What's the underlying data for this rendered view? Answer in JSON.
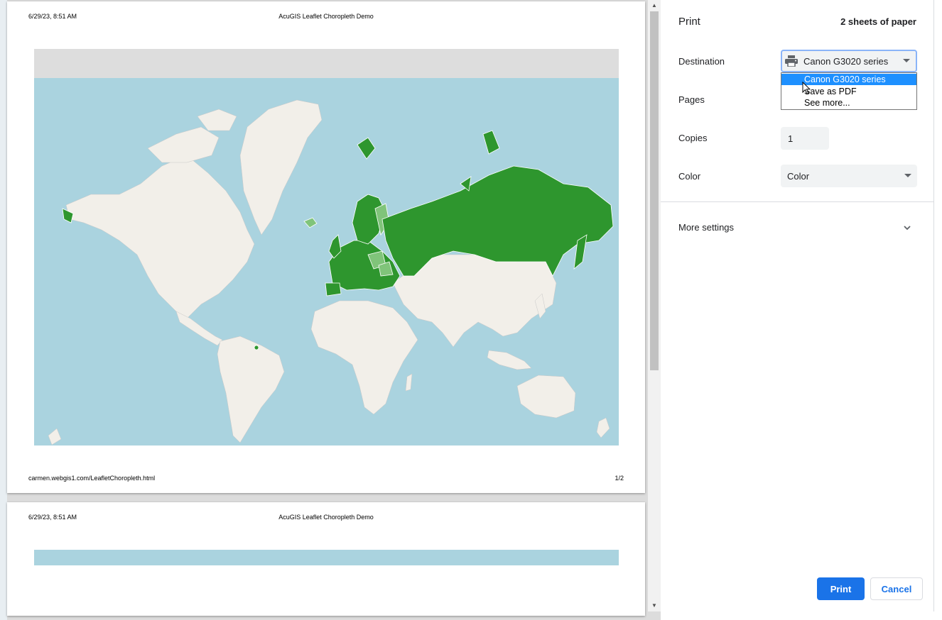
{
  "preview": {
    "page1": {
      "header_date": "6/29/23, 8:51 AM",
      "header_title": "AcuGIS Leaflet Choropleth Demo",
      "footer_url": "carmen.webgis1.com/LeafletChoropleth.html",
      "footer_page": "1/2"
    },
    "page2": {
      "header_date": "6/29/23, 8:51 AM",
      "header_title": "AcuGIS Leaflet Choropleth Demo"
    },
    "map_colors": {
      "ocean": "#aad3df",
      "land": "#f2efe9",
      "choropleth_dark": "#2e962e",
      "choropleth_light": "#80c47a"
    }
  },
  "panel": {
    "title": "Print",
    "sheets": "2 sheets of paper",
    "destination": {
      "label": "Destination",
      "value": "Canon G3020 series",
      "icon": "printer-icon",
      "options": [
        "Canon G3020 series",
        "Save as PDF",
        "See more..."
      ]
    },
    "pages": {
      "label": "Pages"
    },
    "copies": {
      "label": "Copies",
      "value": "1"
    },
    "color": {
      "label": "Color",
      "value": "Color"
    },
    "more_settings": "More settings",
    "print_button": "Print",
    "cancel_button": "Cancel",
    "accent": "#1a73e8"
  }
}
